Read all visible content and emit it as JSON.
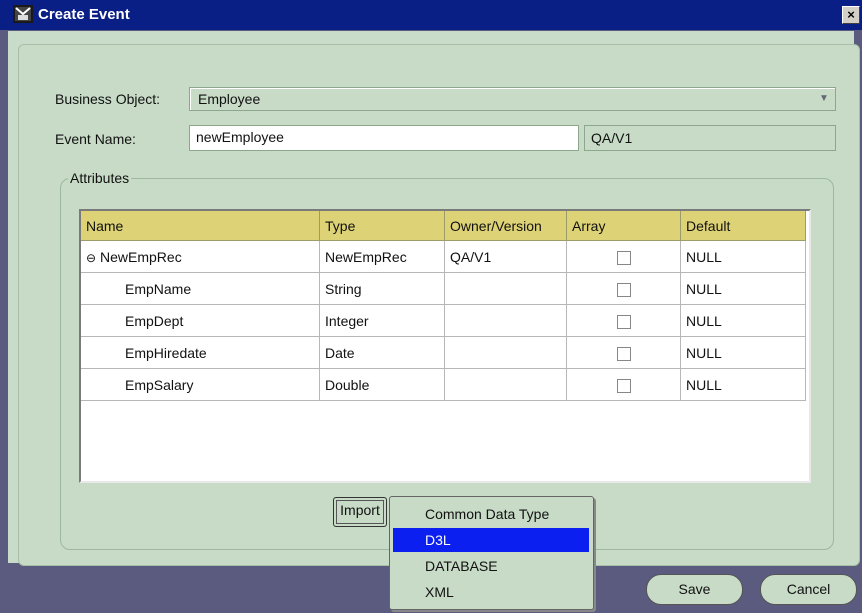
{
  "window": {
    "title": "Create Event",
    "close_glyph": "×"
  },
  "form": {
    "business_object_label": "Business Object:",
    "business_object_value": "Employee",
    "event_name_label": "Event Name:",
    "event_name_value": "newEmployee",
    "owner_version_value": "QA/V1"
  },
  "attributes": {
    "group_label": "Attributes",
    "columns": [
      "Name",
      "Type",
      "Owner/Version",
      "Array",
      "Default"
    ],
    "rows": [
      {
        "name": "NewEmpRec",
        "type": "NewEmpRec",
        "owner": "QA/V1",
        "array": false,
        "default": "NULL",
        "expanded": true
      },
      {
        "name": "EmpName",
        "type": "String",
        "owner": "",
        "array": false,
        "default": "NULL"
      },
      {
        "name": "EmpDept",
        "type": "Integer",
        "owner": "",
        "array": false,
        "default": "NULL"
      },
      {
        "name": "EmpHiredate",
        "type": "Date",
        "owner": "",
        "array": false,
        "default": "NULL"
      },
      {
        "name": "EmpSalary",
        "type": "Double",
        "owner": "",
        "array": false,
        "default": "NULL"
      }
    ]
  },
  "buttons": {
    "import_label": "Import",
    "save_label": "Save",
    "cancel_label": "Cancel"
  },
  "import_menu": {
    "items": [
      "Common Data Type",
      "D3L",
      "DATABASE",
      "XML"
    ],
    "selected": "D3L"
  },
  "icons": {
    "app": "window-icon",
    "collapse": "collapse-icon",
    "dropdown": "chevron-down-icon"
  },
  "colors": {
    "title_bar": "#0a1f86",
    "panel": "#c7dbc7",
    "header": "#ddd275",
    "selection": "#0a1ff0",
    "desktop": "#5a5b7f"
  }
}
